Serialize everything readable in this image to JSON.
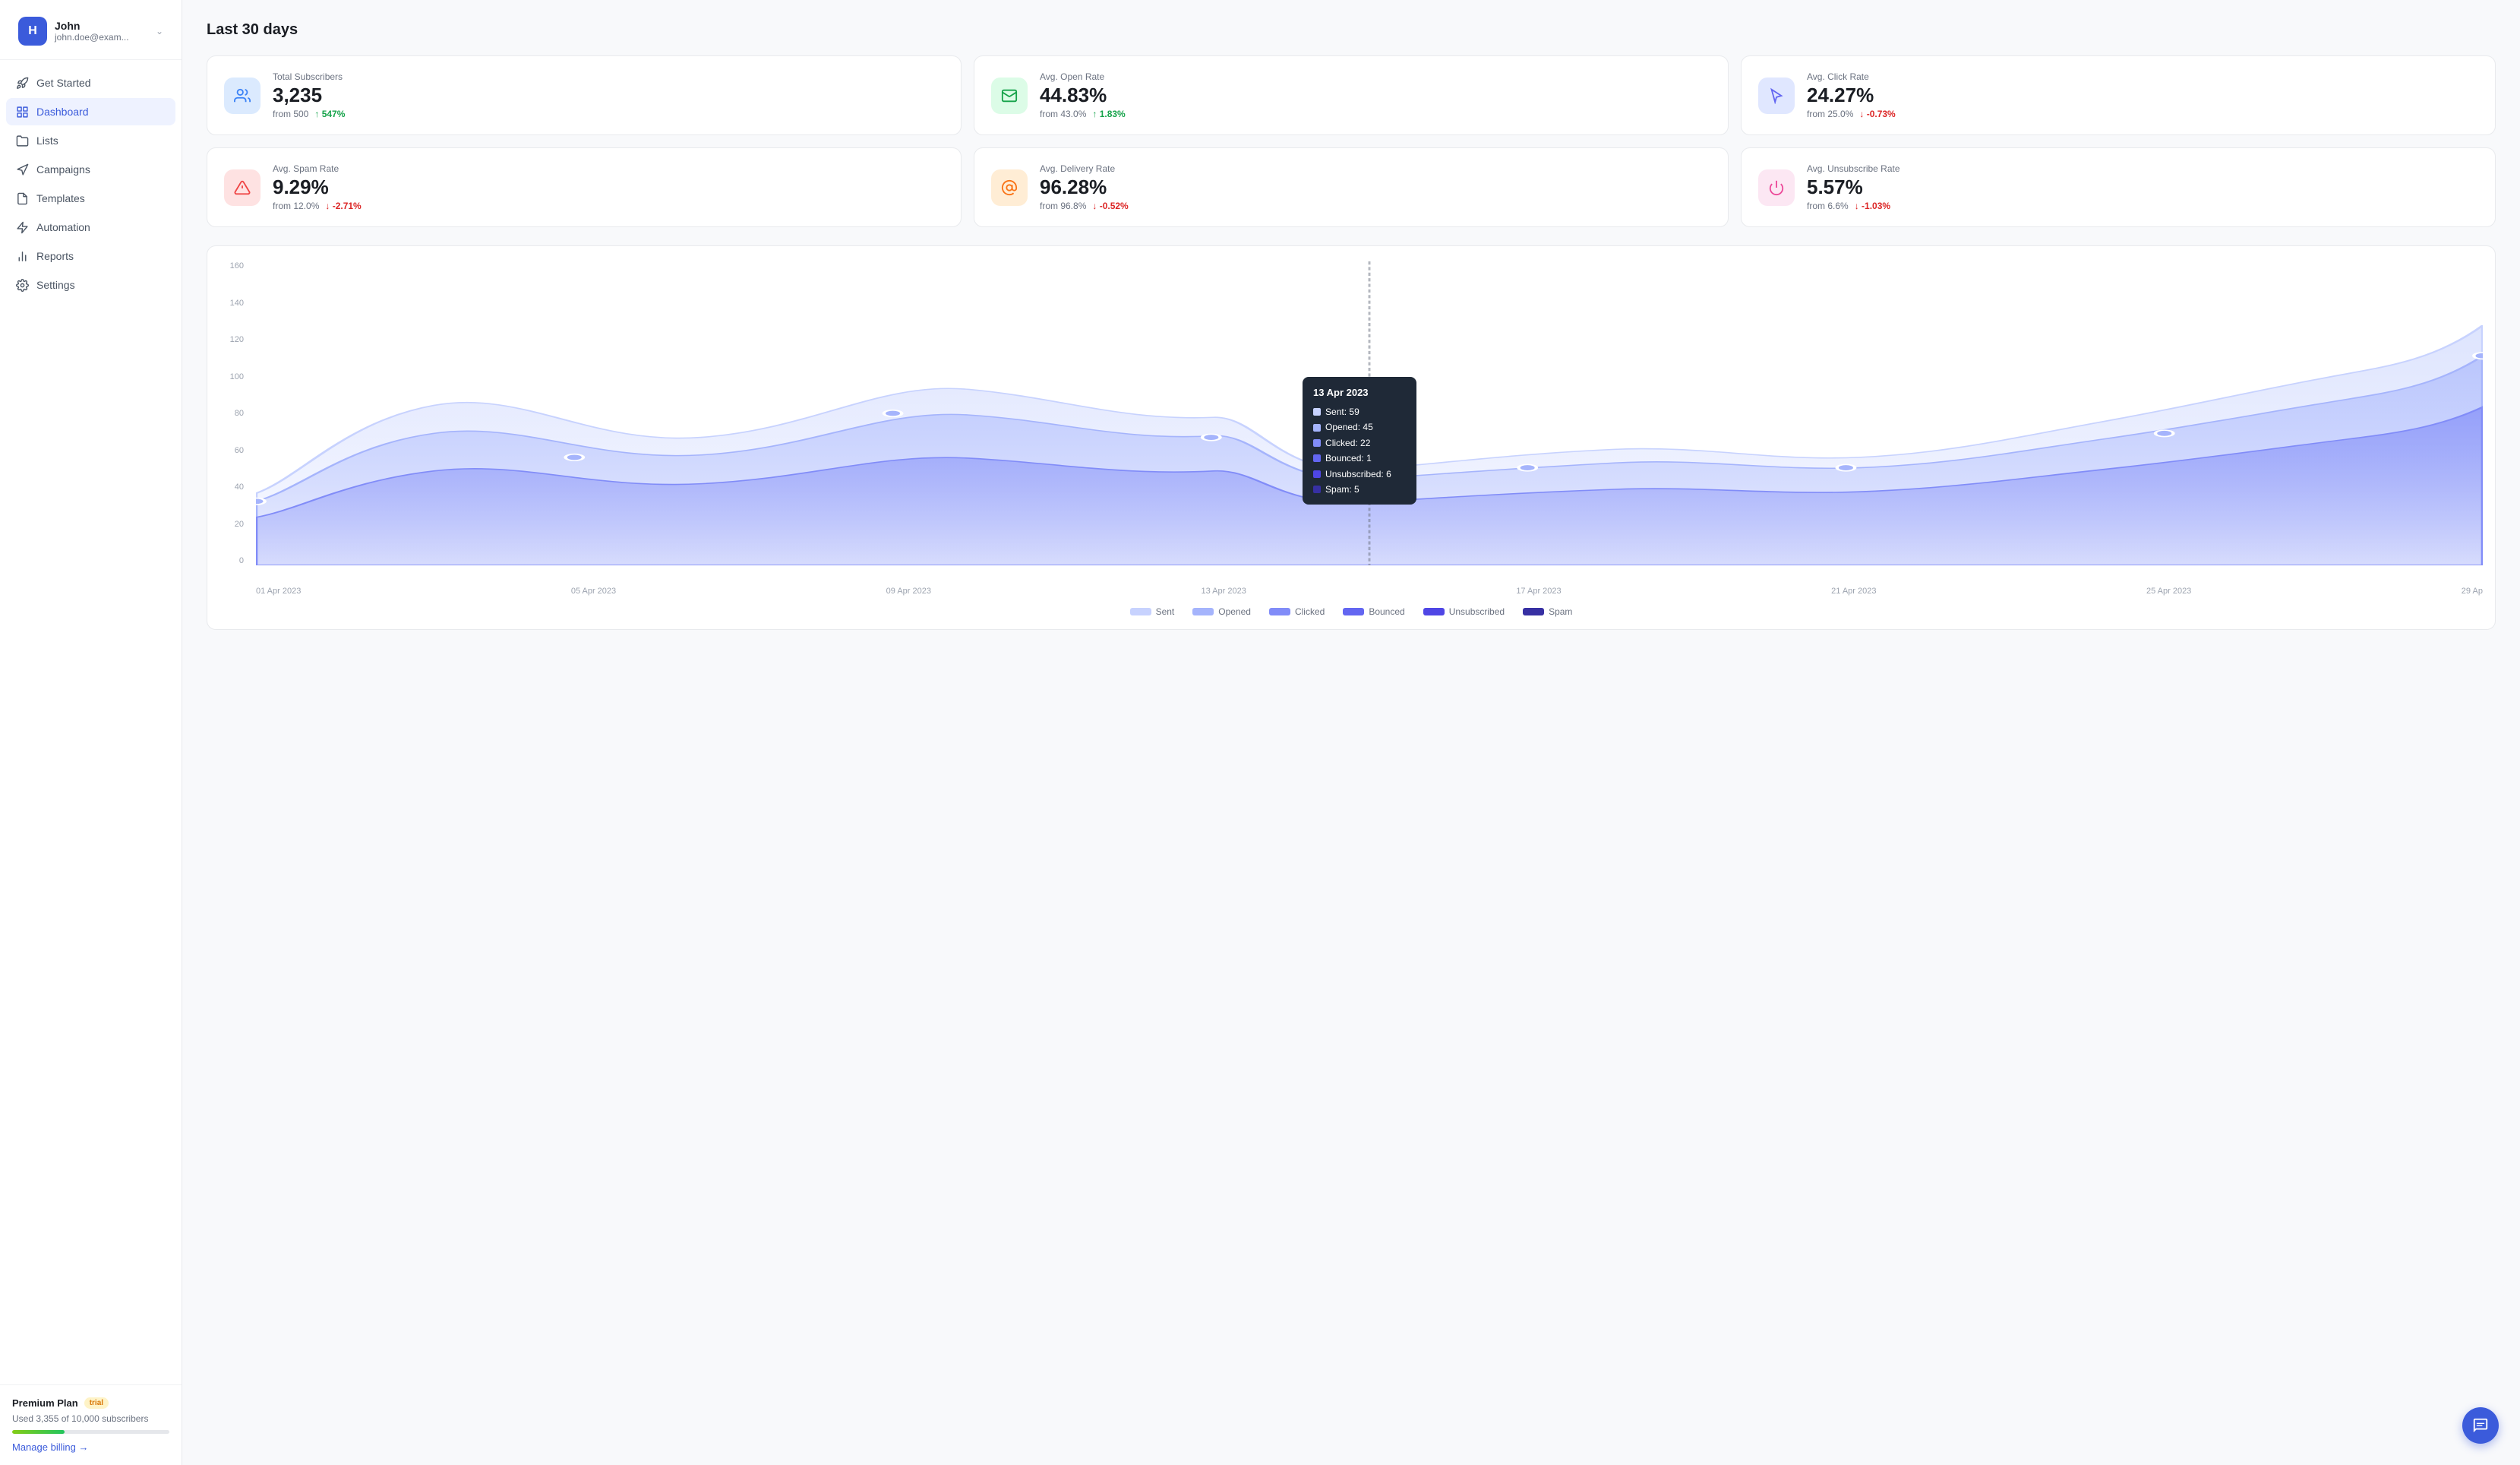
{
  "sidebar": {
    "user": {
      "name": "John",
      "email": "john.doe@exam...",
      "avatar_letter": "H"
    },
    "nav_items": [
      {
        "id": "get-started",
        "label": "Get Started",
        "icon": "rocket"
      },
      {
        "id": "dashboard",
        "label": "Dashboard",
        "icon": "grid",
        "active": true
      },
      {
        "id": "lists",
        "label": "Lists",
        "icon": "folder"
      },
      {
        "id": "campaigns",
        "label": "Campaigns",
        "icon": "megaphone"
      },
      {
        "id": "templates",
        "label": "Templates",
        "icon": "file"
      },
      {
        "id": "automation",
        "label": "Automation",
        "icon": "zap"
      },
      {
        "id": "reports",
        "label": "Reports",
        "icon": "bar-chart"
      },
      {
        "id": "settings",
        "label": "Settings",
        "icon": "gear"
      }
    ],
    "plan": {
      "name": "Premium Plan",
      "badge": "trial",
      "usage_text": "Used 3,355 of 10,000 subscribers",
      "progress_pct": 33.55,
      "manage_billing": "Manage billing →"
    }
  },
  "header": {
    "title": "Last 30 days"
  },
  "stats": [
    {
      "id": "total-subscribers",
      "label": "Total Subscribers",
      "value": "3,235",
      "from_text": "from 500",
      "change": "547%",
      "change_dir": "up",
      "icon_color": "blue",
      "icon": "users"
    },
    {
      "id": "avg-open-rate",
      "label": "Avg. Open Rate",
      "value": "44.83%",
      "from_text": "from 43.0%",
      "change": "1.83%",
      "change_dir": "up",
      "icon_color": "green",
      "icon": "mail"
    },
    {
      "id": "avg-click-rate",
      "label": "Avg. Click Rate",
      "value": "24.27%",
      "from_text": "from 25.0%",
      "change": "-0.73%",
      "change_dir": "down",
      "icon_color": "indigo",
      "icon": "cursor"
    },
    {
      "id": "avg-spam-rate",
      "label": "Avg. Spam Rate",
      "value": "9.29%",
      "from_text": "from 12.0%",
      "change": "-2.71%",
      "change_dir": "down",
      "icon_color": "red",
      "icon": "warning"
    },
    {
      "id": "avg-delivery-rate",
      "label": "Avg. Delivery Rate",
      "value": "96.28%",
      "from_text": "from 96.8%",
      "change": "-0.52%",
      "change_dir": "down",
      "icon_color": "orange",
      "icon": "at"
    },
    {
      "id": "avg-unsubscribe-rate",
      "label": "Avg. Unsubscribe Rate",
      "value": "5.57%",
      "from_text": "from 6.6%",
      "change": "-1.03%",
      "change_dir": "down",
      "icon_color": "pink",
      "icon": "power"
    }
  ],
  "chart": {
    "y_labels": [
      "160",
      "140",
      "120",
      "100",
      "80",
      "60",
      "40",
      "20",
      "0"
    ],
    "x_labels": [
      "01 Apr 2023",
      "05 Apr 2023",
      "09 Apr 2023",
      "13 Apr 2023",
      "17 Apr 2023",
      "21 Apr 2023",
      "25 Apr 2023",
      "29 Ap"
    ],
    "tooltip": {
      "date": "13 Apr 2023",
      "sent": 59,
      "opened": 45,
      "clicked": 22,
      "bounced": 1,
      "unsubscribed": 6,
      "spam": 5
    },
    "legend": [
      {
        "label": "Sent",
        "color": "#c7d2fe"
      },
      {
        "label": "Opened",
        "color": "#a5b4fc"
      },
      {
        "label": "Clicked",
        "color": "#818cf8"
      },
      {
        "label": "Bounced",
        "color": "#6366f1"
      },
      {
        "label": "Unsubscribed",
        "color": "#4f46e5"
      },
      {
        "label": "Spam",
        "color": "#3730a3"
      }
    ]
  }
}
